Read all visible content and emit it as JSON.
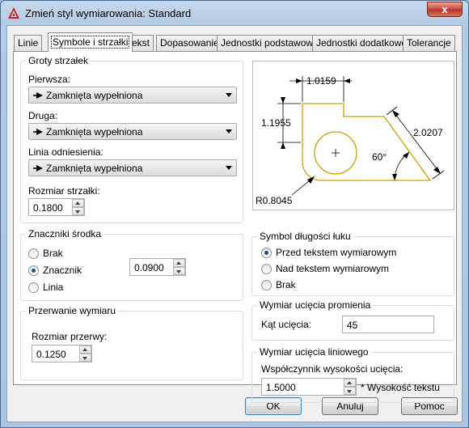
{
  "window": {
    "title": "Zmień styl wymiarowania: Standard",
    "close_glyph": "x"
  },
  "tabs": [
    {
      "label": "Linie",
      "active": false
    },
    {
      "label": "Symbole i strzałki",
      "active": true
    },
    {
      "label": "Tekst",
      "active": false
    },
    {
      "label": "Dopasowanie",
      "active": false
    },
    {
      "label": "Jednostki podstawowe",
      "active": false
    },
    {
      "label": "Jednostki dodatkowe",
      "active": false
    },
    {
      "label": "Tolerancje",
      "active": false
    }
  ],
  "arrowheads": {
    "title": "Groty strzałek",
    "first_label": "Pierwsza:",
    "first_value": "Zamknięta wypełniona",
    "second_label": "Druga:",
    "second_value": "Zamknięta wypełniona",
    "leader_label": "Linia odniesienia:",
    "leader_value": "Zamknięta wypełniona",
    "size_label": "Rozmiar strzałki:",
    "size_value": "0.1800"
  },
  "center_marks": {
    "title": "Znaczniki środka",
    "options": [
      {
        "label": "Brak",
        "checked": false
      },
      {
        "label": "Znacznik",
        "checked": true
      },
      {
        "label": "Linia",
        "checked": false
      }
    ],
    "size_value": "0.0900"
  },
  "dimension_break": {
    "title": "Przerwanie wymiaru",
    "size_label": "Rozmiar przerwy:",
    "size_value": "0.1250"
  },
  "preview": {
    "dim_top": "1.0159",
    "dim_left": "1.1955",
    "dim_diag": "2.0207",
    "dim_angle": "60°",
    "dim_radius": "R0.8045",
    "line_color": "#c8a400",
    "dim_color": "#000000"
  },
  "arc_length": {
    "title": "Symbol długości łuku",
    "options": [
      {
        "label": "Przed tekstem wymiarowym",
        "checked": true
      },
      {
        "label": "Nad tekstem wymiarowym",
        "checked": false
      },
      {
        "label": "Brak",
        "checked": false
      }
    ]
  },
  "radius_jog": {
    "title": "Wymiar ucięcia promienia",
    "angle_label": "Kąt ucięcia:",
    "angle_value": "45"
  },
  "linear_jog": {
    "title": "Wymiar ucięcia liniowego",
    "factor_label": "Współczynnik wysokości ucięcia:",
    "factor_value": "1.5000",
    "suffix": "* Wysokość tekstu"
  },
  "buttons": {
    "ok": "OK",
    "cancel": "Anuluj",
    "help": "Pomoc"
  },
  "colors": {
    "accent": "#1c5180",
    "close_button": "#c9483a"
  }
}
